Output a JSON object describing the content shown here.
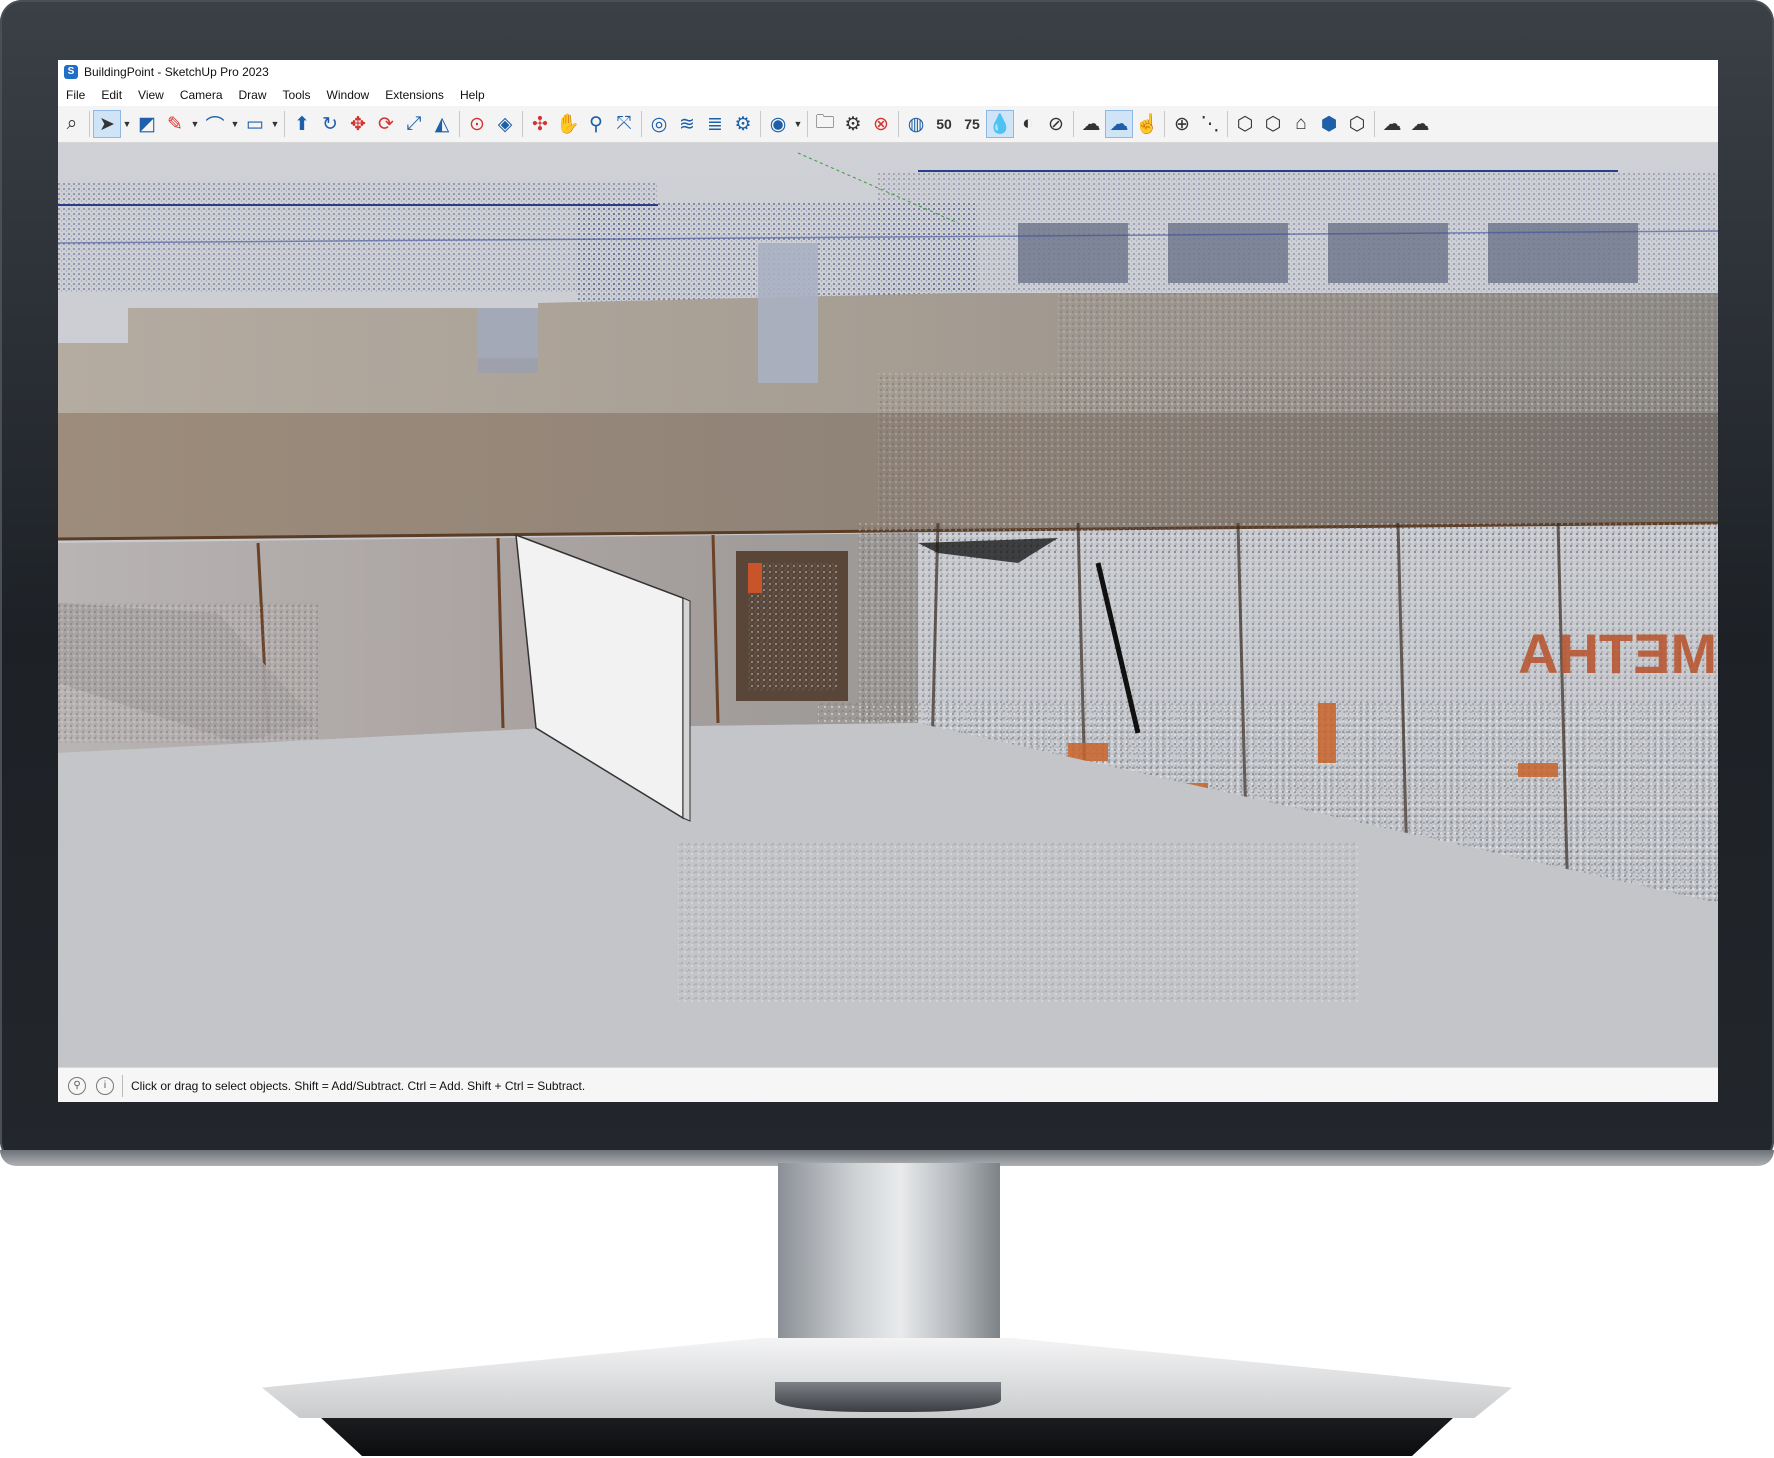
{
  "window": {
    "title": "BuildingPoint - SketchUp Pro 2023"
  },
  "menu": [
    "File",
    "Edit",
    "View",
    "Camera",
    "Draw",
    "Tools",
    "Window",
    "Extensions",
    "Help"
  ],
  "toolbar": {
    "groups": [
      [
        {
          "name": "zoom-icon",
          "glyph": "⌕",
          "cls": "dark"
        }
      ],
      [
        {
          "name": "select-arrow-icon",
          "glyph": "➤",
          "cls": "sel dark"
        },
        {
          "name": "dropdown-icon",
          "glyph": "▼",
          "cls": "dd"
        },
        {
          "name": "eraser-icon",
          "glyph": "◩",
          "cls": ""
        },
        {
          "name": "pencil-line-icon",
          "glyph": "✎",
          "cls": "red"
        },
        {
          "name": "dropdown-icon",
          "glyph": "▼",
          "cls": "dd"
        },
        {
          "name": "arc-icon",
          "glyph": "⌒",
          "cls": ""
        },
        {
          "name": "dropdown-icon",
          "glyph": "▼",
          "cls": "dd"
        },
        {
          "name": "rectangle-icon",
          "glyph": "▭",
          "cls": ""
        },
        {
          "name": "dropdown-icon",
          "glyph": "▼",
          "cls": "dd"
        }
      ],
      [
        {
          "name": "push-pull-icon",
          "glyph": "⬆",
          "cls": ""
        },
        {
          "name": "follow-me-icon",
          "glyph": "↻",
          "cls": ""
        },
        {
          "name": "move-icon",
          "glyph": "✥",
          "cls": "red"
        },
        {
          "name": "rotate-icon",
          "glyph": "⟳",
          "cls": "red"
        },
        {
          "name": "scale-icon",
          "glyph": "⤢",
          "cls": ""
        },
        {
          "name": "offset-icon",
          "glyph": "◭",
          "cls": ""
        }
      ],
      [
        {
          "name": "tape-measure-icon",
          "glyph": "⊙",
          "cls": "red"
        },
        {
          "name": "paint-bucket-icon",
          "glyph": "◈",
          "cls": ""
        }
      ],
      [
        {
          "name": "orbit-icon",
          "glyph": "✣",
          "cls": "red"
        },
        {
          "name": "pan-icon",
          "glyph": "✋",
          "cls": "red"
        },
        {
          "name": "zoom-window-icon",
          "glyph": "⚲",
          "cls": ""
        },
        {
          "name": "zoom-extents-icon",
          "glyph": "⤧",
          "cls": ""
        }
      ],
      [
        {
          "name": "scan-essentials-icon",
          "glyph": "◎",
          "cls": ""
        },
        {
          "name": "point-cloud-layers-icon",
          "glyph": "≋",
          "cls": ""
        },
        {
          "name": "layers-stack-icon",
          "glyph": "≣",
          "cls": ""
        },
        {
          "name": "cloud-settings-icon",
          "glyph": "⚙",
          "cls": ""
        }
      ],
      [
        {
          "name": "user-account-icon",
          "glyph": "◉",
          "cls": ""
        },
        {
          "name": "dropdown-icon",
          "glyph": "▼",
          "cls": "dd"
        }
      ],
      [
        {
          "name": "open-folder-icon",
          "glyph": "🗀",
          "cls": "dark"
        },
        {
          "name": "gear-icon",
          "glyph": "⚙",
          "cls": "dark"
        },
        {
          "name": "close-circle-icon",
          "glyph": "⊗",
          "cls": "red"
        }
      ],
      [
        {
          "name": "scan-visibility-icon",
          "glyph": "◍",
          "cls": ""
        },
        {
          "name": "density-50-icon",
          "glyph": "50",
          "cls": "dark"
        },
        {
          "name": "density-75-icon",
          "glyph": "75",
          "cls": "dark"
        },
        {
          "name": "drop-icon",
          "glyph": "💧",
          "cls": "sel"
        },
        {
          "name": "contrast-icon",
          "glyph": "◐",
          "cls": "dark"
        },
        {
          "name": "hatch-icon",
          "glyph": "⊘",
          "cls": "dark"
        }
      ],
      [
        {
          "name": "cloud-remove-icon",
          "glyph": "☁",
          "cls": "dark"
        },
        {
          "name": "cloud-download-icon",
          "glyph": "☁",
          "cls": "sel"
        },
        {
          "name": "hand-pointer-icon",
          "glyph": "☝",
          "cls": ""
        }
      ],
      [
        {
          "name": "add-point-icon",
          "glyph": "⊕",
          "cls": "dark"
        },
        {
          "name": "dotted-line-icon",
          "glyph": "⋱",
          "cls": "dark"
        }
      ],
      [
        {
          "name": "clock-cube-icon",
          "glyph": "⬡",
          "cls": "dark"
        },
        {
          "name": "cube-outline-icon",
          "glyph": "⬡",
          "cls": "dark"
        },
        {
          "name": "house-cube-icon",
          "glyph": "⌂",
          "cls": "dark"
        },
        {
          "name": "solid-cube-icon",
          "glyph": "⬢",
          "cls": ""
        },
        {
          "name": "wire-cube-icon",
          "glyph": "⬡",
          "cls": "dark"
        }
      ],
      [
        {
          "name": "cloud-sync-icon",
          "glyph": "☁",
          "cls": "dark"
        },
        {
          "name": "cloud-refresh-icon",
          "glyph": "☁",
          "cls": "dark"
        }
      ]
    ]
  },
  "status": {
    "message": "Click or drag to select objects. Shift = Add/Subtract. Ctrl = Add. Shift + Ctrl = Subtract."
  },
  "scene": {
    "sign_text": "METHA",
    "colors": {
      "sky": "#c9cbd0",
      "wall": "#a8a29a",
      "floor": "#c2c4c8",
      "panel": "#f1f1f1",
      "accent": "#d4332f"
    }
  }
}
